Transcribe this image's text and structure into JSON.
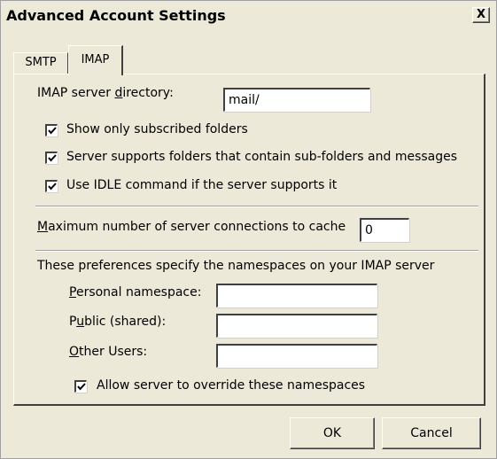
{
  "window": {
    "title": "Advanced Account Settings",
    "close_label": "X"
  },
  "tabs": [
    {
      "label": "SMTP",
      "active": false
    },
    {
      "label": "IMAP",
      "active": true
    }
  ],
  "imap": {
    "server_dir_label_pre": "IMAP server ",
    "server_dir_label_u": "d",
    "server_dir_label_post": "irectory:",
    "server_dir_value": "mail/",
    "show_subscribed_label": "Show only subscribed folders",
    "show_subscribed_checked": true,
    "subfolders_label": "Server supports folders that contain sub-folders and messages",
    "subfolders_checked": true,
    "idle_label": "Use IDLE command if the server supports it",
    "idle_checked": true,
    "max_conn_label_u": "M",
    "max_conn_label_post": "aximum number of server connections to cache",
    "max_conn_value": "0",
    "namespaces_intro": "These preferences specify the namespaces on your IMAP server",
    "personal_label_u": "P",
    "personal_label_post": "ersonal namespace:",
    "personal_value": "",
    "public_label_pre": "P",
    "public_label_u": "u",
    "public_label_post": "blic (shared):",
    "public_value": "",
    "other_label_u": "O",
    "other_label_post": "ther Users:",
    "other_value": "",
    "override_label": "Allow server to override these namespaces",
    "override_checked": true
  },
  "buttons": {
    "ok": "OK",
    "cancel": "Cancel"
  }
}
